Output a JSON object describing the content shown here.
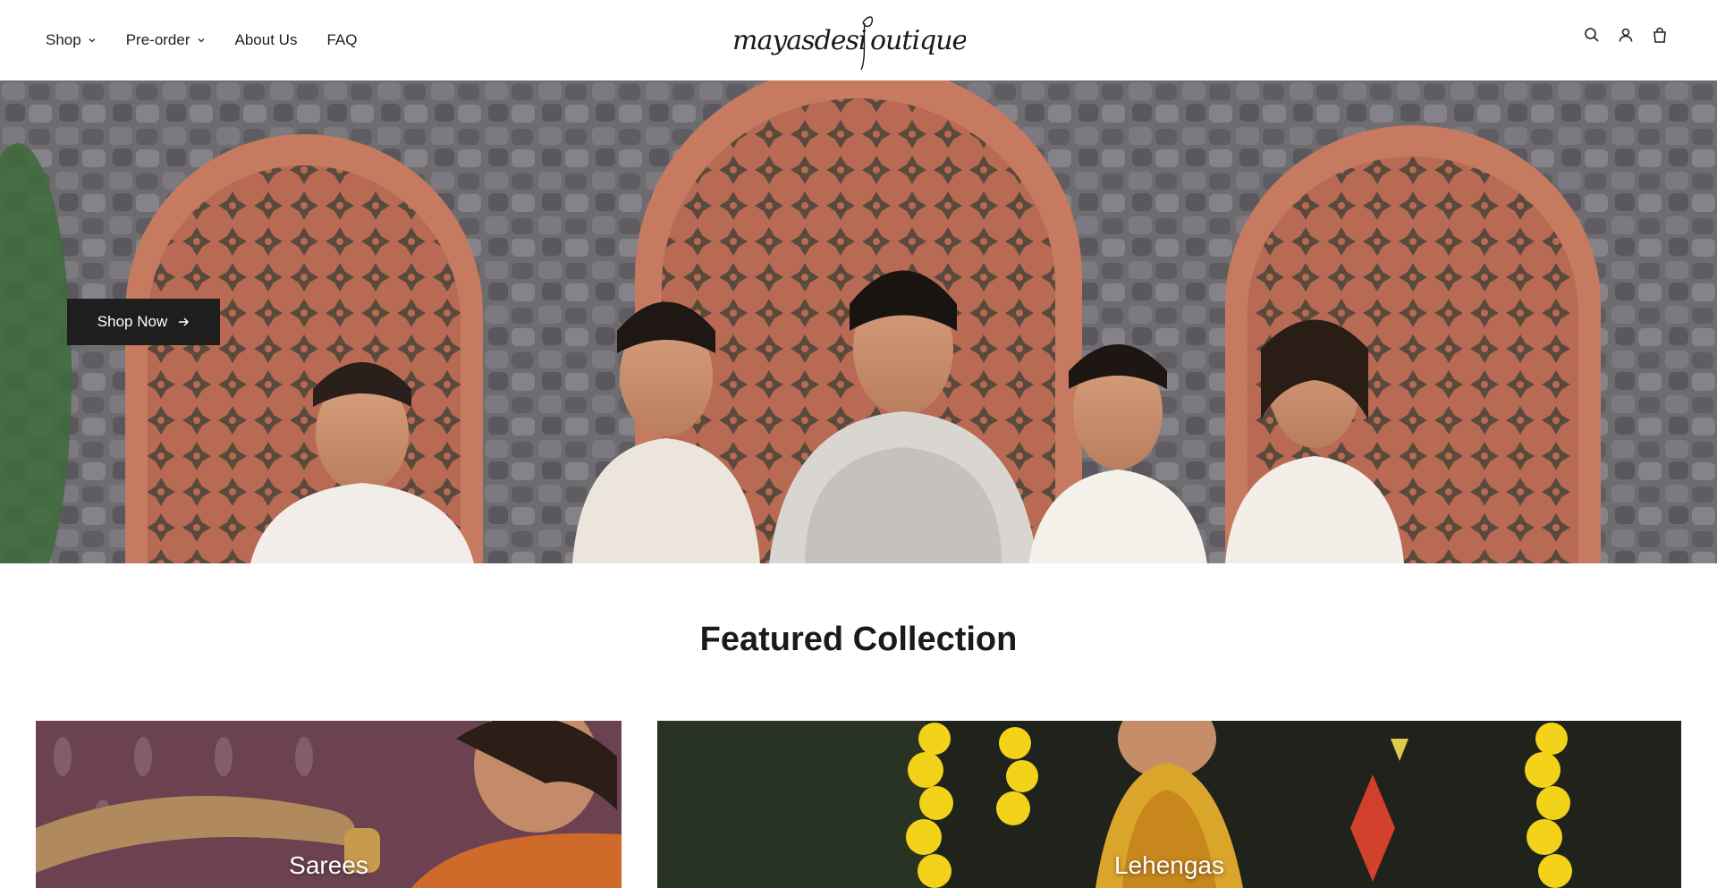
{
  "header": {
    "nav": [
      {
        "label": "Shop",
        "has_dropdown": true
      },
      {
        "label": "Pre-order",
        "has_dropdown": true
      },
      {
        "label": "About Us",
        "has_dropdown": false
      },
      {
        "label": "FAQ",
        "has_dropdown": false
      }
    ],
    "logo_text": "mayasdesiboutique",
    "icons": [
      "search-icon",
      "account-icon",
      "cart-icon"
    ]
  },
  "hero": {
    "cta_label": "Shop Now",
    "cta_icon": "arrow-right-icon"
  },
  "featured": {
    "title": "Featured Collection",
    "collections": [
      {
        "label": "Sarees"
      },
      {
        "label": "Lehengas"
      }
    ]
  },
  "colors": {
    "button_bg": "#1e1e1e",
    "text": "#1c1c1c",
    "brick": "#b86a55",
    "stone": "#6e6c70"
  }
}
